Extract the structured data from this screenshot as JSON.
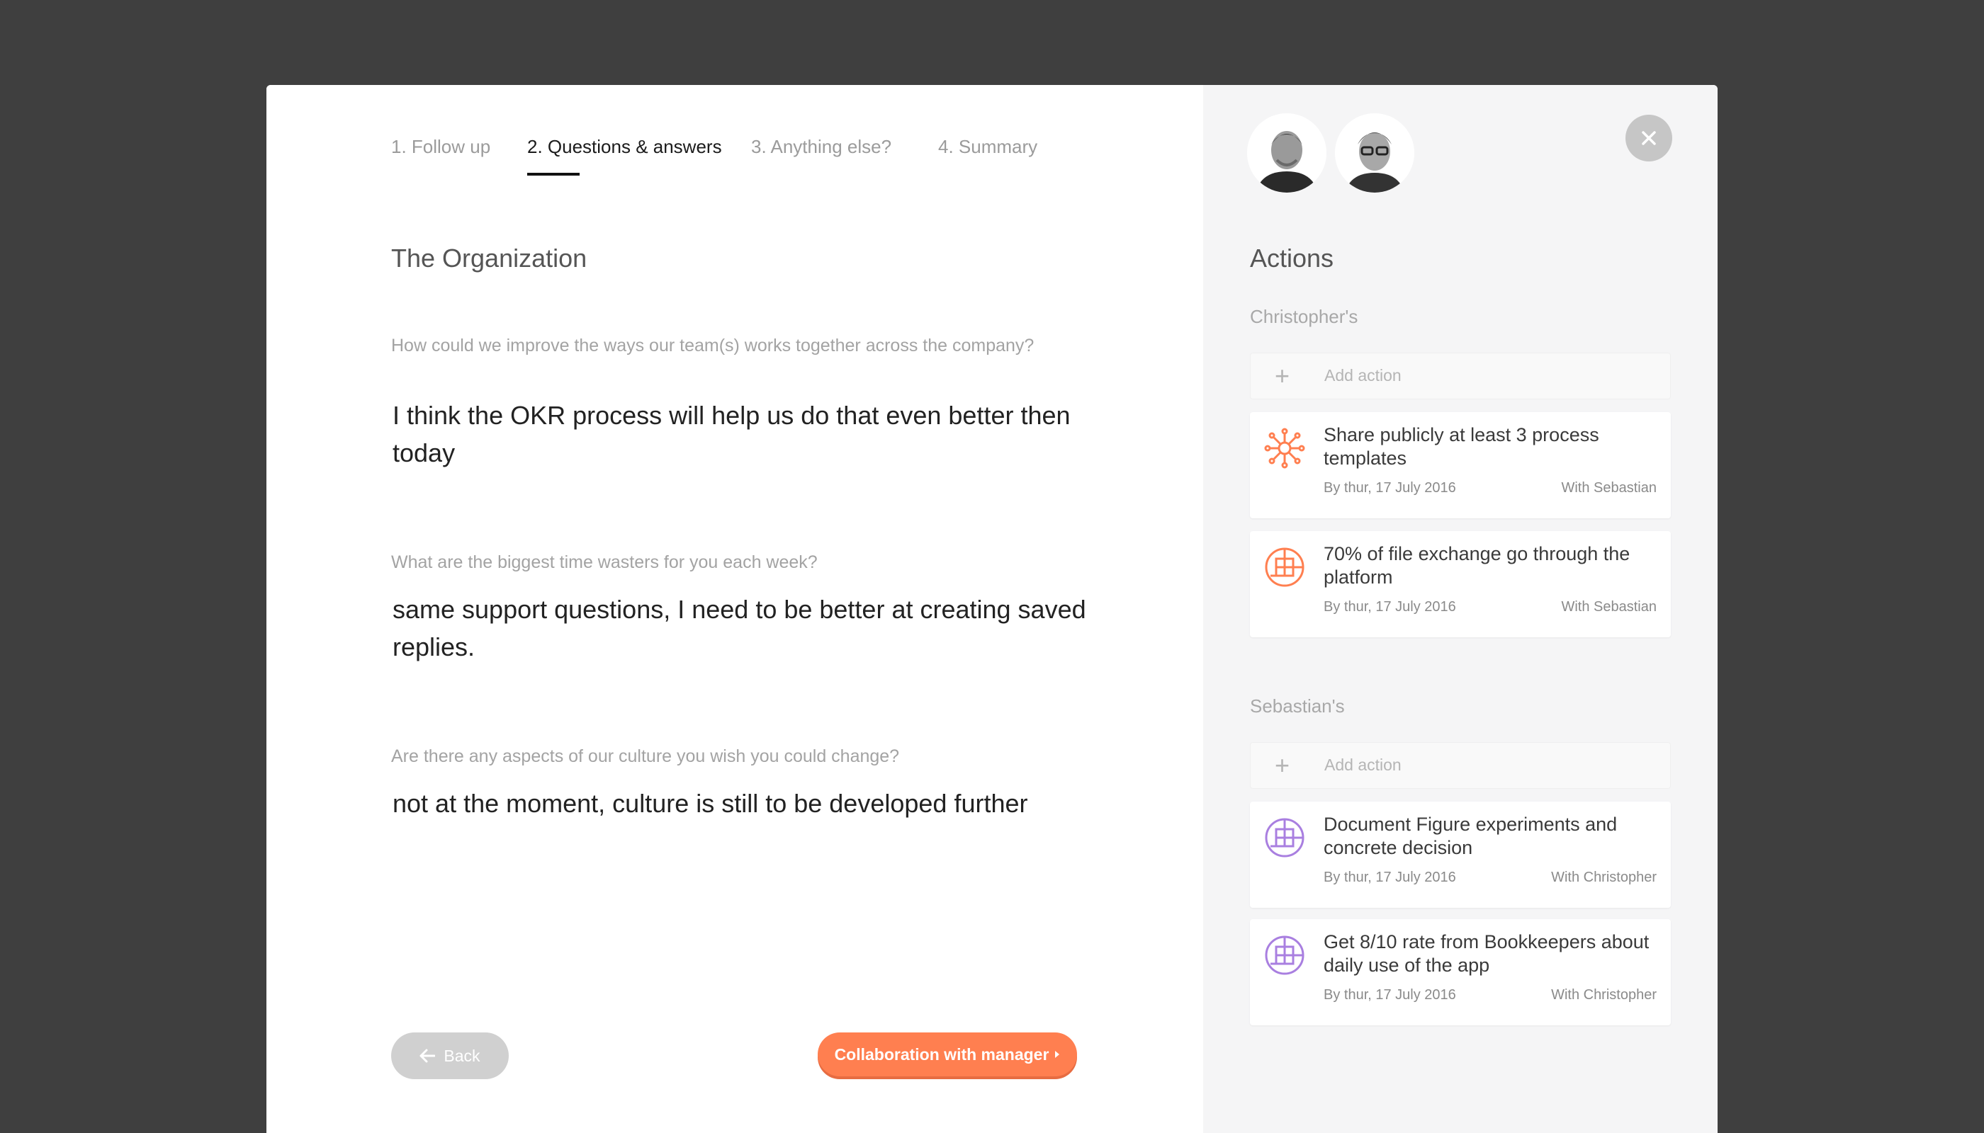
{
  "steps": [
    {
      "label": "1. Follow up"
    },
    {
      "label": "2. Questions & answers"
    },
    {
      "label": "3. Anything else?"
    },
    {
      "label": "4. Summary"
    }
  ],
  "main": {
    "section_title": "The Organization",
    "qa": [
      {
        "question": "How could we improve the ways our team(s) works together across the company?",
        "answer": "I think the OKR process will help us do that even better then today"
      },
      {
        "question": "What are the biggest time wasters for you each week?",
        "answer": "same support questions, I need to be better at creating saved replies."
      },
      {
        "question": "Are there any aspects of our culture you wish you could change?",
        "answer": "not at the moment, culture is still to be developed further"
      }
    ],
    "back_label": "Back",
    "collab_label": "Collaboration with manager"
  },
  "actions": {
    "title": "Actions",
    "add_label": "Add action",
    "groups": [
      {
        "title": "Christopher's",
        "cards": [
          {
            "title": "Share publicly at least 3 process templates",
            "date": "By thur, 17 July 2016",
            "with": "With Sebastian",
            "icon": "network-icon"
          },
          {
            "title": "70% of file exchange go through the platform",
            "date": "By thur, 17 July 2016",
            "with": "With Sebastian",
            "icon": "grid-circle-icon"
          }
        ]
      },
      {
        "title": "Sebastian's",
        "cards": [
          {
            "title": "Document Figure experiments and concrete decision",
            "date": "By thur, 17 July 2016",
            "with": "With Christopher",
            "icon": "grid-circle-icon"
          },
          {
            "title": "Get 8/10 rate from Bookkeepers about daily use of the app",
            "date": "By thur, 17 July 2016",
            "with": "With Christopher",
            "icon": "grid-circle-icon"
          }
        ]
      }
    ]
  },
  "colors": {
    "accent": "#ff7f50",
    "purple": "#a97fe0",
    "backdrop": "#3f3f3f"
  }
}
